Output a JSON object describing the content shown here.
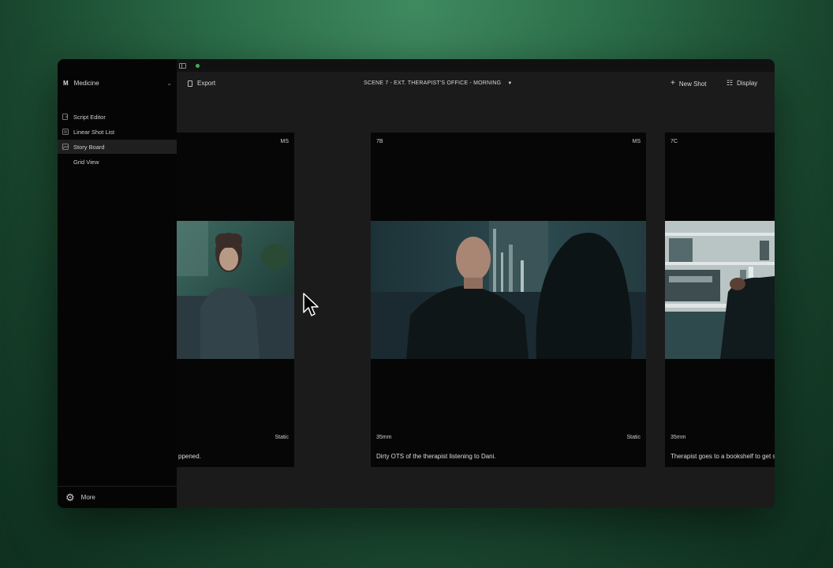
{
  "topbar": {},
  "sidebar": {
    "project_logo": "M",
    "project_name": "Medicine",
    "items": [
      {
        "label": "Script Editor",
        "icon": "script-icon"
      },
      {
        "label": "Linear Shot List",
        "icon": "list-icon"
      },
      {
        "label": "Story Board",
        "icon": "storyboard-icon"
      },
      {
        "label": "Grid View",
        "icon": ""
      }
    ],
    "more_label": "More"
  },
  "toolbar": {
    "export_label": "Export",
    "scene_title": "SCENE 7 - EXT. THERAPIST'S OFFICE - MORNING",
    "new_shot_label": "New Shot",
    "display_label": "Display"
  },
  "shots": [
    {
      "id": "",
      "size": "MS",
      "lens": "",
      "movement": "Static",
      "description": "ppened."
    },
    {
      "id": "7B",
      "size": "MS",
      "lens": "35mm",
      "movement": "Static",
      "description": "Dirty OTS of the therapist listening to Dani."
    },
    {
      "id": "7C",
      "size": "",
      "lens": "35mm",
      "movement": "",
      "description": "Therapist goes to a bookshelf to get something"
    }
  ],
  "colors": {
    "accent_dot": "#3fae5a",
    "background": "#2a6b47"
  }
}
